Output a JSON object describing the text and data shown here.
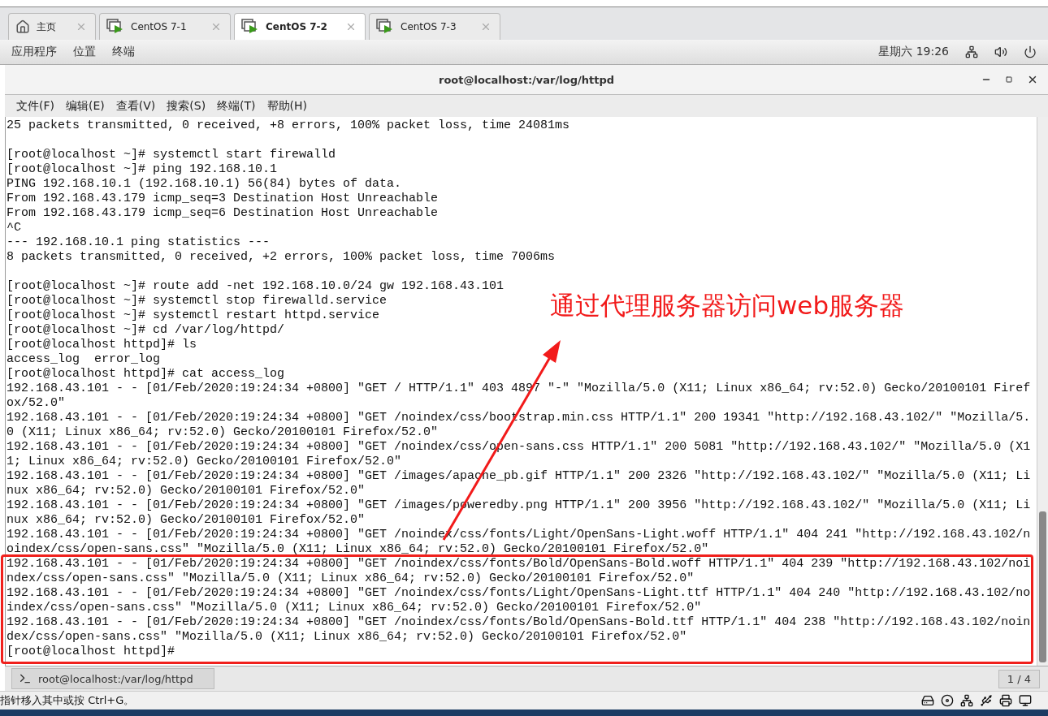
{
  "tabs": [
    {
      "label": "主页",
      "kind": "home",
      "selected": false
    },
    {
      "label": "CentOS 7-1",
      "kind": "vm",
      "selected": false
    },
    {
      "label": "CentOS 7-2",
      "kind": "vm",
      "selected": true
    },
    {
      "label": "CentOS 7-3",
      "kind": "vm",
      "selected": false
    }
  ],
  "top_bar": {
    "menus": [
      "应用程序",
      "位置",
      "终端"
    ],
    "clock": "星期六 19:26"
  },
  "window": {
    "title": "root@localhost:/var/log/httpd"
  },
  "menu_bar": [
    "文件(F)",
    "编辑(E)",
    "查看(V)",
    "搜索(S)",
    "终端(T)",
    "帮助(H)"
  ],
  "terminal": {
    "blocks": [
      [
        "25 packets transmitted, 0 received, +8 errors, 100% packet loss, time 24081ms"
      ],
      [
        "[root@localhost ~]# systemctl start firewalld",
        "[root@localhost ~]# ping 192.168.10.1",
        "PING 192.168.10.1 (192.168.10.1) 56(84) bytes of data.",
        "From 192.168.43.179 icmp_seq=3 Destination Host Unreachable",
        "From 192.168.43.179 icmp_seq=6 Destination Host Unreachable",
        "^C",
        "--- 192.168.10.1 ping statistics ---",
        "8 packets transmitted, 0 received, +2 errors, 100% packet loss, time 7006ms"
      ],
      [
        "[root@localhost ~]# route add -net 192.168.10.0/24 gw 192.168.43.101",
        "[root@localhost ~]# systemctl stop firewalld.service",
        "[root@localhost ~]# systemctl restart httpd.service",
        "[root@localhost ~]# cd /var/log/httpd/",
        "[root@localhost httpd]# ls",
        "access_log  error_log",
        "[root@localhost httpd]# cat access_log",
        "192.168.43.101 - - [01/Feb/2020:19:24:34 +0800] \"GET / HTTP/1.1\" 403 4897 \"-\" \"Mozilla/5.0 (X11; Linux x86_64; rv:52.0) Gecko/20100101 Firef",
        "ox/52.0\"",
        "192.168.43.101 - - [01/Feb/2020:19:24:34 +0800] \"GET /noindex/css/bootstrap.min.css HTTP/1.1\" 200 19341 \"http://192.168.43.102/\" \"Mozilla/5.",
        "0 (X11; Linux x86_64; rv:52.0) Gecko/20100101 Firefox/52.0\"",
        "192.168.43.101 - - [01/Feb/2020:19:24:34 +0800] \"GET /noindex/css/open-sans.css HTTP/1.1\" 200 5081 \"http://192.168.43.102/\" \"Mozilla/5.0 (X1",
        "1; Linux x86_64; rv:52.0) Gecko/20100101 Firefox/52.0\"",
        "192.168.43.101 - - [01/Feb/2020:19:24:34 +0800] \"GET /images/apache_pb.gif HTTP/1.1\" 200 2326 \"http://192.168.43.102/\" \"Mozilla/5.0 (X11; Li",
        "nux x86_64; rv:52.0) Gecko/20100101 Firefox/52.0\"",
        "192.168.43.101 - - [01/Feb/2020:19:24:34 +0800] \"GET /images/poweredby.png HTTP/1.1\" 200 3956 \"http://192.168.43.102/\" \"Mozilla/5.0 (X11; Li",
        "nux x86_64; rv:52.0) Gecko/20100101 Firefox/52.0\"",
        "192.168.43.101 - - [01/Feb/2020:19:24:34 +0800] \"GET /noindex/css/fonts/Light/OpenSans-Light.woff HTTP/1.1\" 404 241 \"http://192.168.43.102/n",
        "oindex/css/open-sans.css\" \"Mozilla/5.0 (X11; Linux x86_64; rv:52.0) Gecko/20100101 Firefox/52.0\"",
        "192.168.43.101 - - [01/Feb/2020:19:24:34 +0800] \"GET /noindex/css/fonts/Bold/OpenSans-Bold.woff HTTP/1.1\" 404 239 \"http://192.168.43.102/noi",
        "ndex/css/open-sans.css\" \"Mozilla/5.0 (X11; Linux x86_64; rv:52.0) Gecko/20100101 Firefox/52.0\"",
        "192.168.43.101 - - [01/Feb/2020:19:24:34 +0800] \"GET /noindex/css/fonts/Light/OpenSans-Light.ttf HTTP/1.1\" 404 240 \"http://192.168.43.102/no",
        "index/css/open-sans.css\" \"Mozilla/5.0 (X11; Linux x86_64; rv:52.0) Gecko/20100101 Firefox/52.0\"",
        "192.168.43.101 - - [01/Feb/2020:19:24:34 +0800] \"GET /noindex/css/fonts/Bold/OpenSans-Bold.ttf HTTP/1.1\" 404 238 \"http://192.168.43.102/noin",
        "dex/css/open-sans.css\" \"Mozilla/5.0 (X11; Linux x86_64; rv:52.0) Gecko/20100101 Firefox/52.0\"",
        "[root@localhost httpd]# "
      ]
    ]
  },
  "annotation": {
    "text": "通过代理服务器访问web服务器"
  },
  "taskbar": {
    "item": "root@localhost:/var/log/httpd",
    "workspace": "1 / 4"
  },
  "status_bar": {
    "hint": "指针移入其中或按 Ctrl+G。"
  }
}
